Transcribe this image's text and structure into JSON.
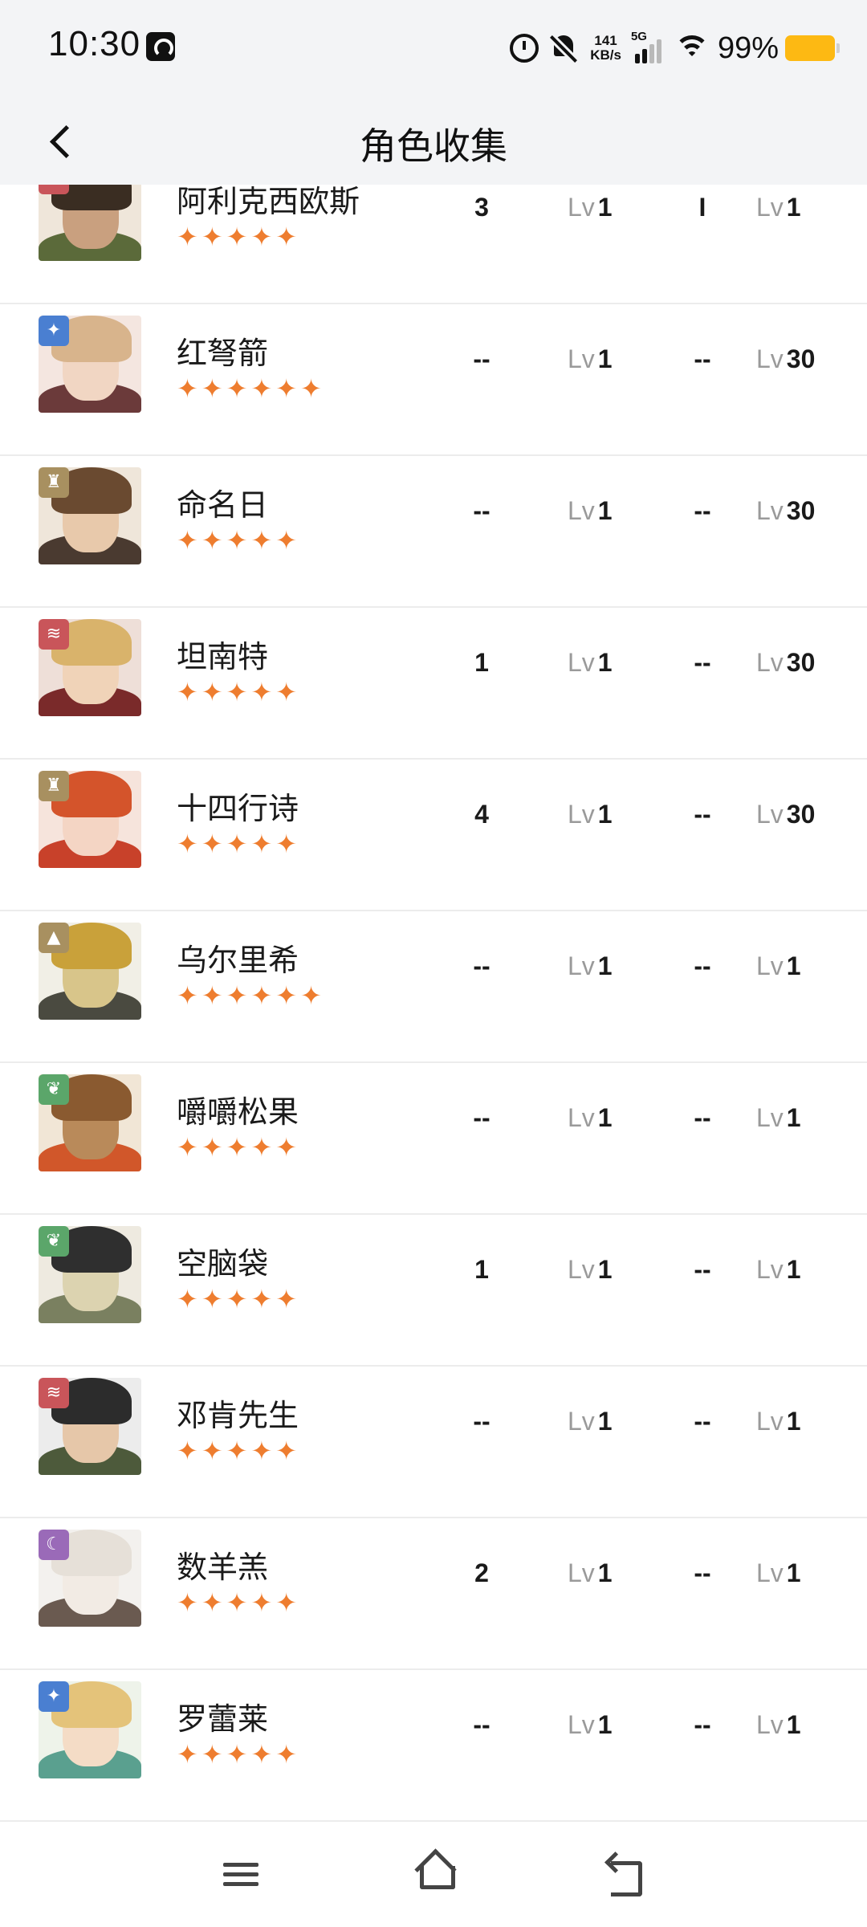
{
  "status_bar": {
    "time": "10:30",
    "net_speed_value": "141",
    "net_speed_unit": "KB/s",
    "network": "5G",
    "battery": "99%",
    "battery_color": "#fdb913"
  },
  "header": {
    "title": "角色收集"
  },
  "colors": {
    "star": "#ee7d2f",
    "badge_red": "#c9555a",
    "badge_blue": "#4a7fd1",
    "badge_gold": "#a89060",
    "badge_green": "#5ba66a",
    "badge_purple": "#9a6ab8"
  },
  "characters": [
    {
      "name": "阿利克西欧斯",
      "stars": "✦✦✦✦✦",
      "class_icon": "beast-claw-icon",
      "col1": "3",
      "lv1": "1",
      "col2": "I",
      "lv2": "1"
    },
    {
      "name": "红弩箭",
      "stars": "✦✦✦✦✦✦",
      "class_icon": "star-spark-icon",
      "col1": "--",
      "lv1": "1",
      "col2": "--",
      "lv2": "30"
    },
    {
      "name": "命名日",
      "stars": "✦✦✦✦✦",
      "class_icon": "intellect-icon",
      "col1": "--",
      "lv1": "1",
      "col2": "--",
      "lv2": "30"
    },
    {
      "name": "坦南特",
      "stars": "✦✦✦✦✦",
      "class_icon": "beast-claw-icon",
      "col1": "1",
      "lv1": "1",
      "col2": "--",
      "lv2": "30"
    },
    {
      "name": "十四行诗",
      "stars": "✦✦✦✦✦",
      "class_icon": "intellect-icon",
      "col1": "4",
      "lv1": "1",
      "col2": "--",
      "lv2": "30"
    },
    {
      "name": "乌尔里希",
      "stars": "✦✦✦✦✦✦",
      "class_icon": "mineral-icon",
      "col1": "--",
      "lv1": "1",
      "col2": "--",
      "lv2": "1"
    },
    {
      "name": "嚼嚼松果",
      "stars": "✦✦✦✦✦",
      "class_icon": "plant-leaf-icon",
      "col1": "--",
      "lv1": "1",
      "col2": "--",
      "lv2": "1"
    },
    {
      "name": "空脑袋",
      "stars": "✦✦✦✦✦",
      "class_icon": "plant-leaf-icon",
      "col1": "1",
      "lv1": "1",
      "col2": "--",
      "lv2": "1"
    },
    {
      "name": "邓肯先生",
      "stars": "✦✦✦✦✦",
      "class_icon": "beast-claw-icon",
      "col1": "--",
      "lv1": "1",
      "col2": "--",
      "lv2": "1"
    },
    {
      "name": "数羊羔",
      "stars": "✦✦✦✦✦",
      "class_icon": "spirit-moon-icon",
      "col1": "2",
      "lv1": "1",
      "col2": "--",
      "lv2": "1"
    },
    {
      "name": "罗蕾莱",
      "stars": "✦✦✦✦✦",
      "class_icon": "star-spark-icon",
      "col1": "--",
      "lv1": "1",
      "col2": "--",
      "lv2": "1"
    }
  ],
  "level_prefix": "Lv"
}
